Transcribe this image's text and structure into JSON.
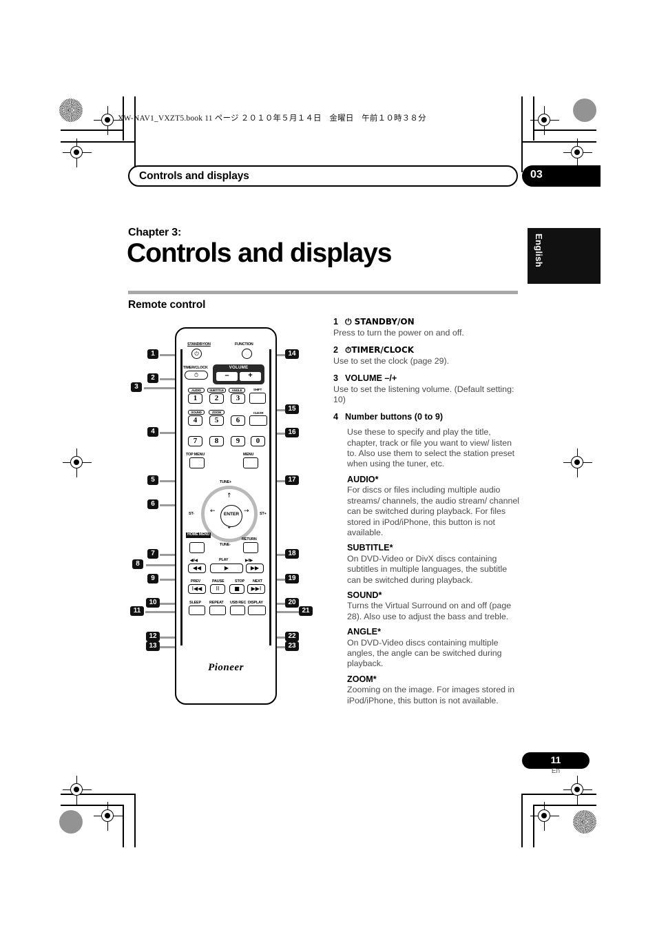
{
  "print_slug": "XW-NAV1_VXZT5.book   11 ページ   ２０１０年５月１４日　金曜日　午前１０時３８分",
  "running_head": {
    "title": "Controls and displays",
    "chapter_number": "03"
  },
  "chapter": {
    "label": "Chapter 3:",
    "title": "Controls and displays"
  },
  "language_tab": "English",
  "section_title": "Remote control",
  "footer": {
    "page": "11",
    "lang": "En"
  },
  "descriptions": [
    {
      "num": "1",
      "head": "⏻ STANDBY/ON",
      "body": "Press to turn the power on and off.",
      "subs": []
    },
    {
      "num": "2",
      "head": "⏱TIMER/CLOCK",
      "body": "Use to set the clock (page 29).",
      "subs": []
    },
    {
      "num": "3",
      "head": "VOLUME –/+",
      "body": "Use to set the listening volume. (Default setting: 10)",
      "subs": []
    },
    {
      "num": "4",
      "head": "Number buttons (0 to 9)",
      "body": "",
      "indent_body": "Use these to specify and play the title, chapter, track or file you want to view/ listen to. Also use them to select the station preset when using the tuner, etc.",
      "subs": [
        {
          "head": "AUDIO*",
          "body": "For discs or files including multiple audio streams/ channels, the audio stream/ channel can be switched during playback. For files stored in iPod/iPhone, this button is not available."
        },
        {
          "head": "SUBTITLE*",
          "body": "On DVD-Video or DivX discs containing subtitles in multiple languages, the subtitle can be switched during playback."
        },
        {
          "head": "SOUND*",
          "body": "Turns the Virtual Surround on and off (page 28). Also use to adjust the bass and treble."
        },
        {
          "head": "ANGLE*",
          "body": "On DVD-Video discs containing multiple angles, the angle can be switched during playback."
        },
        {
          "head": "ZOOM*",
          "body": "Zooming on the image. For images stored in iPod/iPhone, this button is not available."
        }
      ]
    }
  ],
  "remote": {
    "brand": "Pioneer",
    "labels": {
      "standby": "STANDBY/ON",
      "function": "FUNCTION",
      "timer_clock": "TIMER/CLOCK",
      "volume": "VOLUME",
      "volume_minus": "–",
      "volume_plus": "+",
      "audio": "AUDIO",
      "subtitle": "SUBTITLE",
      "angle": "ANGLE",
      "sound": "SOUND",
      "zoom": "ZOOM",
      "shift": "SHIFT",
      "clear": "CLEAR",
      "top_menu": "TOP MENU",
      "menu": "MENU",
      "home_menu": "HOME MENU",
      "return": "RETURN",
      "tune_plus": "TUNE+",
      "tune_minus": "TUNE-",
      "st_minus": "ST-",
      "st_plus": "ST+",
      "enter": "ENTER",
      "play": "PLAY",
      "prev": "PREV",
      "pause": "PAUSE",
      "stop": "STOP",
      "next": "NEXT",
      "sleep": "SLEEP",
      "repeat": "REPEAT",
      "usb_rec": "USB REC",
      "display": "DISPLAY",
      "scan_rev": "◀I/◀",
      "scan_fwd": "▶/I▶"
    },
    "numbers": [
      "1",
      "2",
      "3",
      "4",
      "5",
      "6",
      "7",
      "8",
      "9",
      "0"
    ],
    "glyphs": {
      "power": "⏻",
      "clock": "⏱",
      "play": "▶",
      "rew": "◀◀",
      "ff": "▶▶",
      "prev": "I◀◀",
      "next": "▶▶I",
      "pause": "II",
      "stop": "■",
      "up": "↑",
      "down": "↓",
      "left": "←",
      "right": "→"
    },
    "callouts_left": [
      "1",
      "2",
      "3",
      "4",
      "5",
      "6",
      "7",
      "8",
      "9",
      "10",
      "11",
      "12",
      "13"
    ],
    "callouts_right": [
      "14",
      "15",
      "16",
      "17",
      "18",
      "19",
      "20",
      "21",
      "22",
      "23"
    ]
  }
}
